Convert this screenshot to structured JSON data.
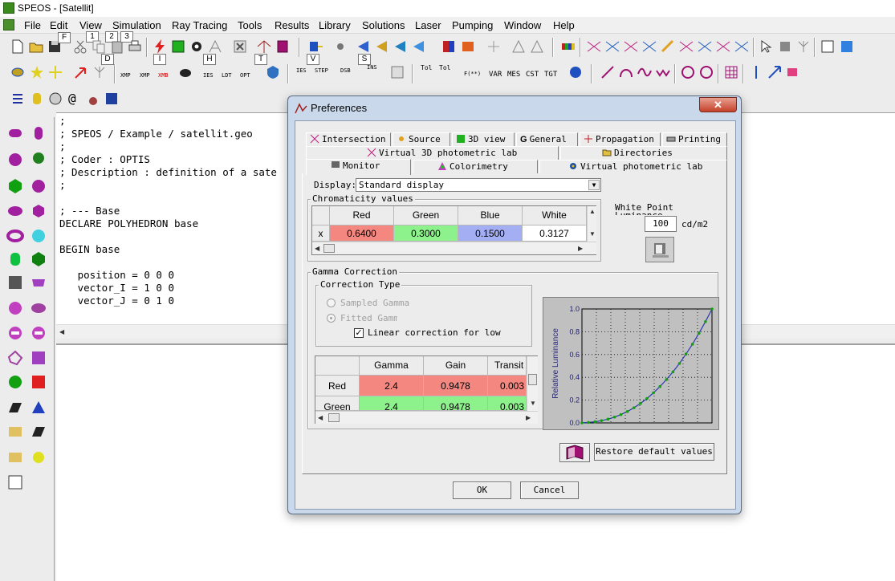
{
  "window": {
    "title": "SPEOS - [Satellit]"
  },
  "menu": [
    "File",
    "Edit",
    "View",
    "Simulation",
    "Ray Tracing",
    "Tools",
    "Results",
    "Library",
    "Solutions",
    "Laser",
    "Pumping",
    "Window",
    "Help"
  ],
  "hint_keys": {
    "row1": [
      "F",
      "1",
      "2",
      "3"
    ],
    "row2": [
      "D",
      "I",
      "H",
      "T",
      "V",
      "S"
    ]
  },
  "toolbar_text": {
    "xmp1": "XMP",
    "xmp2": "XMP",
    "xmb": "XMB",
    "ies": "IES",
    "ldt": "LDT",
    "opt": "OPT",
    "ies2": "IES",
    "step": "STEP",
    "dsb": "DSB",
    "ins": "INS",
    "tol1": "Tol",
    "tol2": "Tol",
    "fxx": "F(**)",
    "var": "VAR",
    "mes": "MES",
    "cst": "CST",
    "tgt": "TGT"
  },
  "editor": {
    "lines": [
      ";",
      "; SPEOS / Example / satellit.geo",
      ";",
      "; Coder : OPTIS",
      "; Description : definition of a sate",
      ";",
      "",
      "; --- Base",
      "DECLARE POLYHEDRON base",
      "",
      "BEGIN base",
      "",
      "   position = 0 0 0",
      "   vector_I = 1 0 0",
      "   vector_J = 0 1 0"
    ]
  },
  "dialog": {
    "title": "Preferences",
    "tabs_row1": [
      "Intersection",
      "Source",
      "3D view",
      "General",
      "Propagation",
      "Printing"
    ],
    "tabs_row2": [
      "Virtual 3D photometric lab",
      "Directories"
    ],
    "tabs_row3": [
      "Monitor",
      "Colorimetry",
      "Virtual  photometric lab"
    ],
    "display_label": "Display:",
    "display_value": "Standard display",
    "chromaticity": {
      "title": "Chromaticity values",
      "columns": [
        "Red",
        "Green",
        "Blue",
        "White"
      ],
      "row_label": "x",
      "values": [
        "0.6400",
        "0.3000",
        "0.1500",
        "0.3127"
      ],
      "colors": [
        "#f4877f",
        "#8ef28c",
        "#a3aef3",
        "#ffffff"
      ]
    },
    "white_point": {
      "label": "White Point",
      "sublabel": "Luminance",
      "value": "100",
      "unit": "cd/m2"
    },
    "gamma": {
      "title": "Gamma Correction",
      "correction_type": "Correction Type",
      "sampled": "Sampled Gamma",
      "fitted": "Fitted Gamma",
      "linear": "Linear correction for low lu",
      "columns": [
        "Gamma",
        "Gain",
        "Transit"
      ],
      "rows": [
        {
          "label": "Red",
          "gamma": "2.4",
          "gain": "0.9478",
          "transit": "0.003"
        },
        {
          "label": "Green",
          "gamma": "2.4",
          "gain": "0.9478",
          "transit": "0.003"
        }
      ],
      "row_colors": [
        "#f4877f",
        "#8ef28c"
      ]
    },
    "restore_button": "Restore default values",
    "ok_button": "OK",
    "cancel_button": "Cancel"
  },
  "chart_data": {
    "type": "line",
    "title": "",
    "xlabel": "",
    "ylabel": "Relative Luminance",
    "xlim": [
      0,
      1
    ],
    "ylim": [
      0,
      1
    ],
    "yticks": [
      "0.0",
      "0.2",
      "0.4",
      "0.6",
      "0.8",
      "1.0"
    ],
    "grid": true,
    "x": [
      0,
      0.05,
      0.1,
      0.15,
      0.2,
      0.25,
      0.3,
      0.35,
      0.4,
      0.45,
      0.5,
      0.55,
      0.6,
      0.65,
      0.7,
      0.75,
      0.8,
      0.85,
      0.9,
      0.95,
      1.0
    ],
    "y": [
      0,
      0.004,
      0.01,
      0.02,
      0.033,
      0.051,
      0.073,
      0.1,
      0.133,
      0.171,
      0.214,
      0.264,
      0.319,
      0.381,
      0.448,
      0.522,
      0.604,
      0.691,
      0.787,
      0.889,
      1.0
    ]
  }
}
